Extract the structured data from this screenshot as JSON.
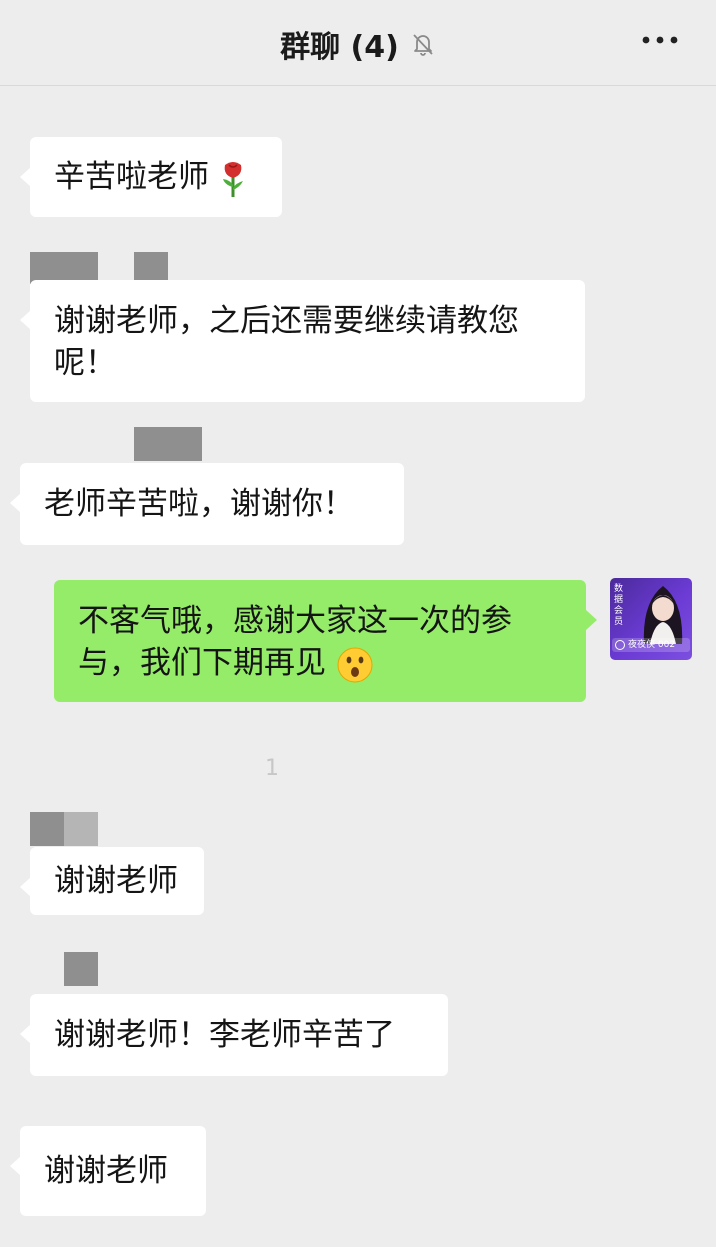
{
  "header": {
    "title": "群聊 (4)",
    "mute_icon": "bell-muted-icon",
    "more_icon": "more-dots-icon"
  },
  "messages": [
    {
      "text": "辛苦啦老师",
      "emoji": "rose-emoji",
      "sender": "other"
    },
    {
      "text": "谢谢老师，之后还需要继续请教您\n呢！",
      "sender": "other"
    },
    {
      "text": "老师辛苦啦，谢谢你！",
      "sender": "other"
    },
    {
      "text": "不客气哦，感谢大家这一次的参\n与，我们下期再见",
      "emoji": "astonished-face-emoji",
      "sender": "me"
    },
    {
      "text": "谢谢老师",
      "sender": "other"
    },
    {
      "text": "谢谢老师！李老师辛苦了",
      "sender": "other"
    },
    {
      "text": "谢谢老师",
      "sender": "other"
    }
  ],
  "timestamp": "1",
  "avatar": {
    "tag": "数据会员",
    "name": "夜夜侠 002"
  },
  "colors": {
    "background": "#ededed",
    "bubble_other": "#ffffff",
    "bubble_mine": "#95ec69"
  }
}
